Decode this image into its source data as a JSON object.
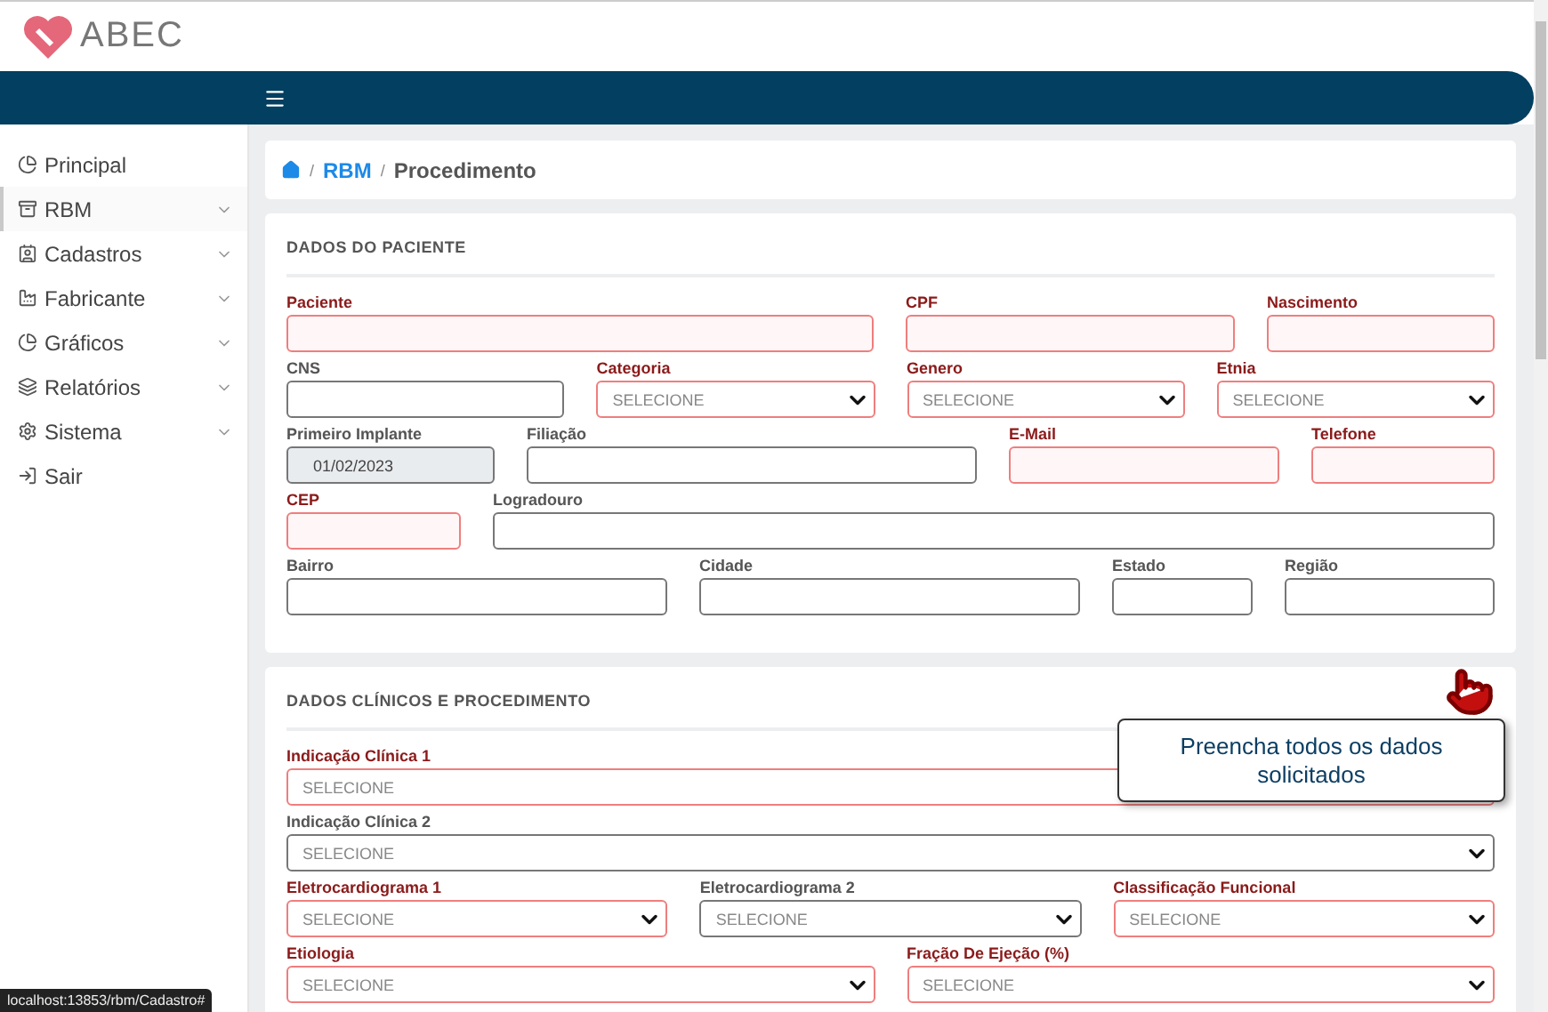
{
  "logo": {
    "text": "ABEC"
  },
  "sidebar": {
    "items": [
      {
        "label": "Principal",
        "kind": "chart",
        "expandable": false,
        "selected": false
      },
      {
        "label": "RBM",
        "kind": "archive",
        "expandable": true,
        "selected": true
      },
      {
        "label": "Cadastros",
        "kind": "card",
        "expandable": true,
        "selected": false
      },
      {
        "label": "Fabricante",
        "kind": "factory",
        "expandable": true,
        "selected": false
      },
      {
        "label": "Gráficos",
        "kind": "chart",
        "expandable": true,
        "selected": false
      },
      {
        "label": "Relatórios",
        "kind": "layers",
        "expandable": true,
        "selected": false
      },
      {
        "label": "Sistema",
        "kind": "gear",
        "expandable": true,
        "selected": false
      },
      {
        "label": "Sair",
        "kind": "exit",
        "expandable": false,
        "selected": false
      }
    ]
  },
  "breadcrumb": {
    "items": [
      {
        "separator": "/",
        "label": "RBM",
        "current": false
      },
      {
        "separator": "/",
        "label": "Procedimento",
        "current": true
      }
    ]
  },
  "sections": [
    {
      "title": "DADOS DO PACIENTE",
      "groups": [
        {
          "fields": [
            {
              "label": "Paciente",
              "kind": "text",
              "required": true
            },
            {
              "label": "CPF",
              "kind": "text",
              "required": true
            },
            {
              "label": "Nascimento",
              "kind": "text",
              "required": true
            }
          ]
        },
        {
          "fields": [
            {
              "label": "CNS",
              "kind": "text",
              "required": false
            },
            {
              "label": "Categoria",
              "kind": "select",
              "required": true,
              "placeholder": "SELECIONE"
            },
            {
              "label": "Genero",
              "kind": "select",
              "required": true,
              "placeholder": "SELECIONE"
            },
            {
              "label": "Etnia",
              "kind": "select",
              "required": true,
              "placeholder": "SELECIONE"
            }
          ]
        },
        {
          "fields": [
            {
              "label": "Primeiro Implante",
              "kind": "text",
              "required": false,
              "disabled": true,
              "value": "01/02/2023"
            },
            {
              "label": "Filiação",
              "kind": "text",
              "required": false
            },
            {
              "label": "E-Mail",
              "kind": "text",
              "required": true
            },
            {
              "label": "Telefone",
              "kind": "text",
              "required": true
            }
          ]
        },
        {
          "fields": [
            {
              "label": "CEP",
              "kind": "text",
              "required": true
            },
            {
              "label": "Logradouro",
              "kind": "text",
              "required": false
            }
          ]
        },
        {
          "fields": [
            {
              "label": "Bairro",
              "kind": "text",
              "required": false
            },
            {
              "label": "Cidade",
              "kind": "text",
              "required": false
            },
            {
              "label": "Estado",
              "kind": "text",
              "required": false
            },
            {
              "label": "Região",
              "kind": "text",
              "required": false
            }
          ]
        }
      ]
    },
    {
      "title": "DADOS CLÍNICOS E PROCEDIMENTO",
      "groups": [
        {
          "fields": [
            {
              "label": "Indicação Clínica 1",
              "kind": "select",
              "required": true,
              "placeholder": "SELECIONE"
            }
          ]
        },
        {
          "fields": [
            {
              "label": "Indicação Clínica 2",
              "kind": "select",
              "required": false,
              "placeholder": "SELECIONE"
            }
          ]
        },
        {
          "fields": [
            {
              "label": "Eletrocardiograma 1",
              "kind": "select",
              "required": true,
              "placeholder": "SELECIONE"
            },
            {
              "label": "Eletrocardiograma 2",
              "kind": "select",
              "required": false,
              "placeholder": "SELECIONE"
            },
            {
              "label": "Classificação Funcional",
              "kind": "select",
              "required": true,
              "placeholder": "SELECIONE"
            }
          ]
        },
        {
          "fields": [
            {
              "label": "Etiologia",
              "kind": "select",
              "required": true,
              "placeholder": "SELECIONE"
            },
            {
              "label": "Fração De Ejeção (%)",
              "kind": "select",
              "required": true,
              "placeholder": "SELECIONE"
            }
          ]
        }
      ]
    }
  ],
  "tooltip": {
    "text": "Preencha todos os dados solicitados"
  },
  "status_bar": {
    "url": "localhost:13853/rbm/Cadastro#"
  }
}
